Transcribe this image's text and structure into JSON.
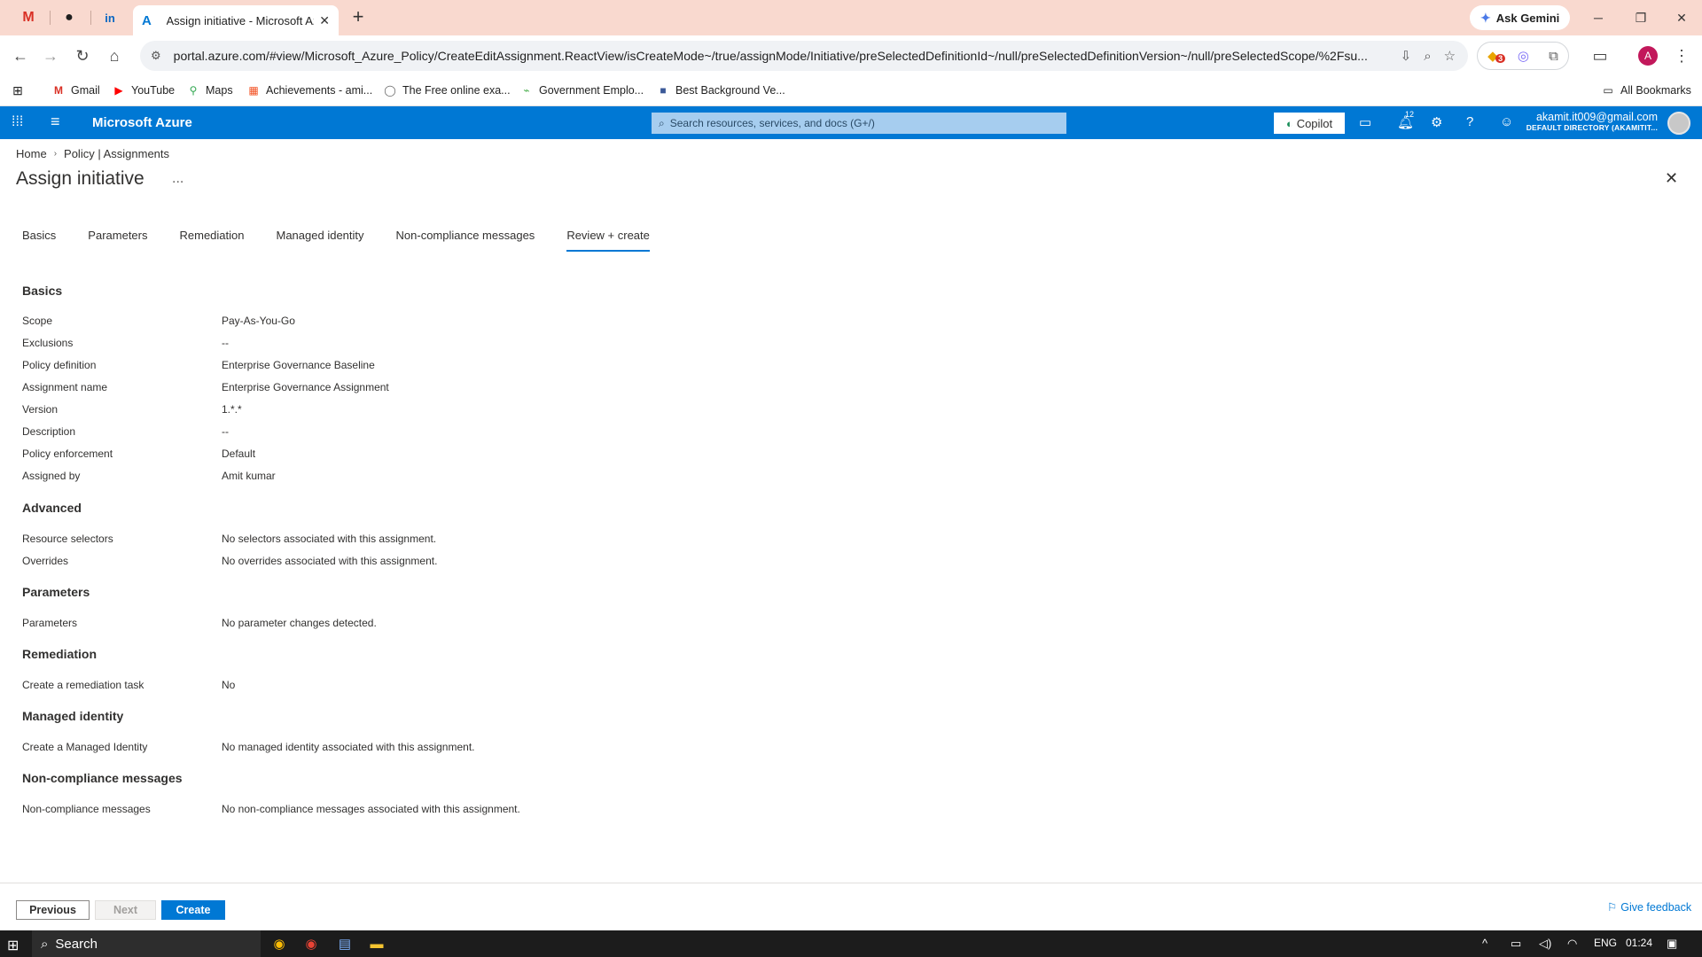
{
  "browser": {
    "pinned_tabs": [
      "Gmail",
      "GitHub",
      "LinkedIn"
    ],
    "active_tab_title": "Assign initiative - Microsoft Azure",
    "ask_gemini": "Ask Gemini",
    "url": "portal.azure.com/#view/Microsoft_Azure_Policy/CreateEditAssignment.ReactView/isCreateMode~/true/assignMode/Initiative/preSelectedDefinitionId~/null/preSelectedDefinitionVersion~/null/preSelectedScope/%2Fsu...",
    "extension_badge": "3",
    "profile_initial": "A",
    "bookmarks": [
      "Gmail",
      "YouTube",
      "Maps",
      "Achievements - ami...",
      "The Free online exa...",
      "Government Emplo...",
      "Best Background Ve..."
    ],
    "all_bookmarks": "All Bookmarks"
  },
  "azure": {
    "brand": "Microsoft Azure",
    "search_placeholder": "Search resources, services, and docs (G+/)",
    "copilot": "Copilot",
    "notifications_count": "12",
    "account_email": "akamit.it009@gmail.com",
    "account_directory": "DEFAULT DIRECTORY (AKAMITIT..."
  },
  "page": {
    "breadcrumb": [
      "Home",
      "Policy | Assignments"
    ],
    "title": "Assign initiative",
    "more": "...",
    "tabs": [
      "Basics",
      "Parameters",
      "Remediation",
      "Managed identity",
      "Non-compliance messages",
      "Review + create"
    ],
    "active_tab": "Review + create"
  },
  "review": {
    "basics": {
      "heading": "Basics",
      "rows": [
        {
          "label": "Scope",
          "value": "Pay-As-You-Go"
        },
        {
          "label": "Exclusions",
          "value": "--"
        },
        {
          "label": "Policy definition",
          "value": "Enterprise Governance Baseline"
        },
        {
          "label": "Assignment name",
          "value": "Enterprise Governance Assignment"
        },
        {
          "label": "Version",
          "value": "1.*.*"
        },
        {
          "label": "Description",
          "value": "--"
        },
        {
          "label": "Policy enforcement",
          "value": "Default"
        },
        {
          "label": "Assigned by",
          "value": "Amit kumar"
        }
      ]
    },
    "advanced": {
      "heading": "Advanced",
      "rows": [
        {
          "label": "Resource selectors",
          "value": "No selectors associated with this assignment."
        },
        {
          "label": "Overrides",
          "value": "No overrides associated with this assignment."
        }
      ]
    },
    "parameters": {
      "heading": "Parameters",
      "rows": [
        {
          "label": "Parameters",
          "value": "No parameter changes detected."
        }
      ]
    },
    "remediation": {
      "heading": "Remediation",
      "rows": [
        {
          "label": "Create a remediation task",
          "value": "No"
        }
      ]
    },
    "managed_identity": {
      "heading": "Managed identity",
      "rows": [
        {
          "label": "Create a Managed Identity",
          "value": "No managed identity associated with this assignment."
        }
      ]
    },
    "noncompliance": {
      "heading": "Non-compliance messages",
      "rows": [
        {
          "label": "Non-compliance messages",
          "value": "No non-compliance messages associated with this assignment."
        }
      ]
    }
  },
  "footer": {
    "previous": "Previous",
    "next": "Next",
    "create": "Create",
    "feedback": "Give feedback"
  },
  "taskbar": {
    "search": "Search",
    "language": "ENG",
    "time": "01:24"
  },
  "colors": {
    "azure_blue": "#0078d4",
    "tab_strip": "#f9d9cf"
  }
}
